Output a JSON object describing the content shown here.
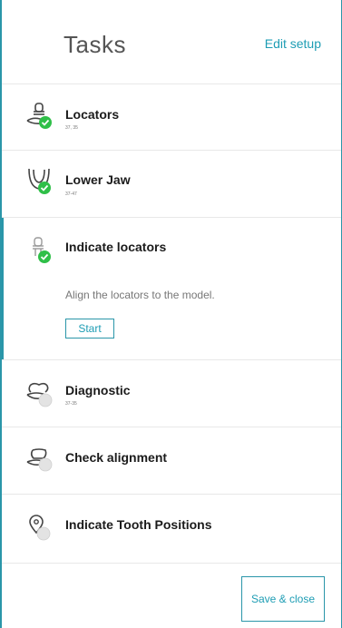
{
  "header": {
    "title": "Tasks",
    "edit_link": "Edit setup"
  },
  "tasks": [
    {
      "name": "Locators",
      "sub": "37, 35",
      "status": "done",
      "icon": "locator-icon"
    },
    {
      "name": "Lower Jaw",
      "sub": "37-47",
      "status": "done",
      "icon": "lower-jaw-icon"
    },
    {
      "name": "Indicate locators",
      "sub": "",
      "status": "done",
      "icon": "locator-outline-icon",
      "description": "Align the locators to the model.",
      "action": "Start"
    },
    {
      "name": "Diagnostic",
      "sub": "37-35",
      "status": "pending",
      "icon": "tooth-icon"
    },
    {
      "name": "Check alignment",
      "sub": "",
      "status": "pending",
      "icon": "alignment-icon"
    },
    {
      "name": "Indicate Tooth Positions",
      "sub": "",
      "status": "pending",
      "icon": "location-pin-icon"
    }
  ],
  "footer": {
    "save_label": "Save & close"
  },
  "colors": {
    "accent": "#2a96a9",
    "link": "#1e9db4",
    "done": "#2fbf48",
    "pending": "#e3e3e3"
  }
}
